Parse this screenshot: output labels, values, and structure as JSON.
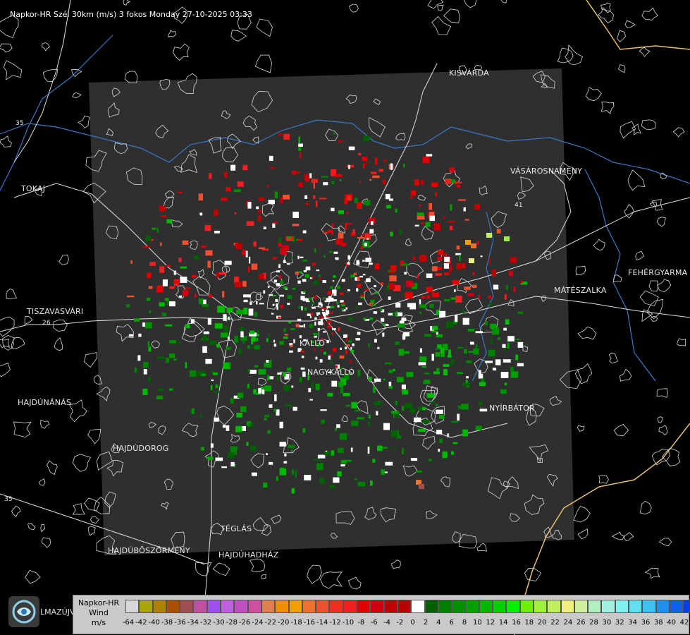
{
  "title": "Napkor-HR Szél 30km (m/s) 3 fokos Monday 27-10-2025 03:33",
  "towns": [
    {
      "id": "kisvarda",
      "label": "KISVÁRDA"
    },
    {
      "id": "vasarosnameny",
      "label": "VÁSÁROSNAMÉNY"
    },
    {
      "id": "tokaj",
      "label": "TOKAJ"
    },
    {
      "id": "fehergyarmat",
      "label": "FEHÉRGYARMA"
    },
    {
      "id": "mateszalka",
      "label": "MÁTÉSZALKA"
    },
    {
      "id": "tiszavasvari",
      "label": "TISZAVASVÁRI"
    },
    {
      "id": "hajdunanas",
      "label": "HAJDÚNÁNÁS"
    },
    {
      "id": "nyirbator",
      "label": "NYÍRBÁTOR"
    },
    {
      "id": "hajdudorog",
      "label": "HAJDÚDOROG"
    },
    {
      "id": "teglas",
      "label": "TÉGLÁS"
    },
    {
      "id": "hajduboszormeny",
      "label": "HAJDÚBÖSZÖRMÉNY"
    },
    {
      "id": "hajduhadhaz",
      "label": "HAJDÚHADHÁZ"
    },
    {
      "id": "nyirbogat",
      "label": "NAGYKÁLLÓ"
    },
    {
      "id": "kallosemjen",
      "label": "KÁLLÓ"
    }
  ],
  "road_numbers": [
    "35",
    "26",
    "41",
    "35"
  ],
  "logo_town": "LMAZÚJVÁR",
  "legend": {
    "title_lines": [
      "Napkor-HR",
      "Wind",
      "m/s"
    ],
    "colors": [
      "#d8d8d8",
      "#a8a800",
      "#b08000",
      "#a85000",
      "#a05050",
      "#c050a0",
      "#a050f0",
      "#c060e0",
      "#c050c0",
      "#d050a0",
      "#e08050",
      "#f09000",
      "#f0a000",
      "#f07030",
      "#f05030",
      "#f03020",
      "#f02020",
      "#e00000",
      "#d00010",
      "#c00000",
      "#b80000",
      "#ffffff",
      "#006000",
      "#008000",
      "#009000",
      "#00a000",
      "#00b800",
      "#00d000",
      "#00f000",
      "#70f000",
      "#a0f040",
      "#c0f060",
      "#f0f080",
      "#d0f0a0",
      "#b0f0c0",
      "#a0f0e0",
      "#80f0f0",
      "#60e0f0",
      "#40c0f0",
      "#2090f0",
      "#1060f0",
      "#0040f0",
      "#0000f0"
    ],
    "ticks": [
      "-64",
      "-42",
      "-40",
      "-38",
      "-36",
      "-34",
      "-32",
      "-30",
      "-28",
      "-26",
      "-24",
      "-22",
      "-20",
      "-18",
      "-16",
      "-14",
      "-12",
      "-10",
      "-8",
      "-6",
      "-4",
      "-2",
      "0",
      "2",
      "4",
      "6",
      "8",
      "10",
      "12",
      "14",
      "16",
      "18",
      "20",
      "22",
      "24",
      "26",
      "28",
      "30",
      "32",
      "34",
      "36",
      "38",
      "40",
      "42"
    ]
  }
}
